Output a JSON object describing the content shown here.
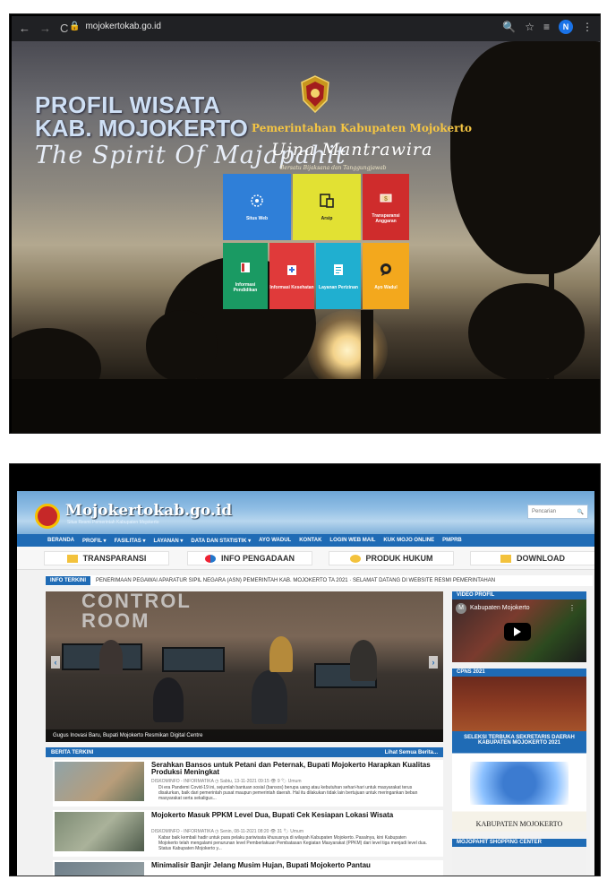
{
  "browser": {
    "url": "mojokertokab.go.id",
    "profile_initial": "N"
  },
  "landing": {
    "title_line1": "PROFIL WISATA",
    "title_line2": "KAB. MOJOKERTO",
    "tagline": "The Spirit Of Majapahit",
    "pemkab": "Pemerintahan Kabupaten Mojokerto",
    "motto": "Ujna Mantrawira",
    "motto_sub": "Bersatu Bijaksana dan Tanggungjawab",
    "tiles": [
      {
        "label": "Situs Web",
        "color": "#2f7fd8",
        "icon": "globe-icon"
      },
      {
        "label": "Arsip",
        "color": "#e2e133",
        "icon": "devices-icon"
      },
      {
        "label": "Transparansi Anggaran",
        "color": "#cf2c2c",
        "icon": "money-icon"
      },
      {
        "label": "Informasi Pendidikan",
        "color": "#1a9a63",
        "icon": "book-icon"
      },
      {
        "label": "Informasi Kesehatan",
        "color": "#e03a3a",
        "icon": "hospital-icon"
      },
      {
        "label": "Layanan Perizinan",
        "color": "#20afd0",
        "icon": "document-icon"
      },
      {
        "label": "Ayo Wadul",
        "color": "#f3a81d",
        "icon": "chat-icon"
      }
    ]
  },
  "site": {
    "logo_text": "Mojokertokab.go.id",
    "logo_sub": "Situs Resmi Pemerintah Kabupaten Mojokerto",
    "search_placeholder": "Pencarian",
    "menu": [
      "BERANDA",
      "PROFIL ▾",
      "FASILITAS ▾",
      "LAYANAN ▾",
      "DATA DAN STATISTIK ▾",
      "AYO WADUL",
      "KONTAK",
      "LOGIN WEB MAIL",
      "KUK MOJO ONLINE",
      "PMPRB"
    ],
    "quick": [
      "TRANSPARANSI",
      "INFO PENGADAAN",
      "PRODUK HUKUM",
      "DOWNLOAD"
    ],
    "ticker_label": "INFO TERKINI",
    "ticker_text": "PENERIMAAN PEGAWAI APARATUR SIPIL NEGARA (ASN) PEMERINTAH KAB. MOJOKERTO TA 2021  ·  SELAMAT DATANG DI WEBSITE RESMI PEMERINTAHAN",
    "slider_room": "CONTROL\nROOM",
    "slider_caption": "Gugus Inovasi Baru, Bupati Mojokerto Resmikan Digital Centre",
    "berita_title": "BERITA TERKINI",
    "berita_all": "Lihat Semua Berita...",
    "news": [
      {
        "title": "Serahkan Bansos untuk Petani dan Peternak, Bupati Mojokerto Harapkan Kualitas Produksi Meningkat",
        "meta": "DISKOMINFO - INFORMATIKA   ◷ Sabtu, 13-11-2021 09:15   👁 9   🏷 Umum",
        "excerpt": "Di era Pandemi Covid-19 ini, sejumlah bantuan sosial (bansos) berupa uang atau kebutuhan sehari-hari untuk masyarakat terus disalurkan, baik dari pemerintah pusat maupun pemerintah daerah. Hal itu dilakukan tidak lain bertujuan untuk meringankan beban masyarakat serta sekaligus..."
      },
      {
        "title": "Mojokerto Masuk PPKM Level Dua, Bupati Cek Kesiapan Lokasi Wisata",
        "meta": "DISKOMINFO - INFORMATIKA   ◷ Senin, 08-11-2021 08:20   👁 31   🏷 Umum",
        "excerpt": "Kabar baik kembali hadir untuk para pelaku pariwisata khususnya di wilayah Kabupaten Mojokerto. Pasalnya, kini Kabupaten Mojokerto telah mengalami penurunan level Pemberlakuan Pembatasan Kegiatan Masyarakat (PPKM) dari level tiga menjadi level dua. Status Kabupaten Mojokerto y..."
      },
      {
        "title": "Minimalisir Banjir Jelang Musim Hujan, Bupati Mojokerto Pantau",
        "meta": "",
        "excerpt": ""
      }
    ],
    "video_title": "VIDEO PROFIL",
    "video_channel": "Kabupaten Mojokerto",
    "video_channel_initial": "M",
    "cpns_title": "CPNS 2021",
    "seleksi_text": "SELEKSI TERBUKA SEKRETARIS DAERAH KABUPATEN MOJOKERTO 2021",
    "seleksi_footer": "KABUPATEN MOJOKERTO",
    "shopping_title": "MOJOPAHIT SHOPPING CENTER"
  }
}
